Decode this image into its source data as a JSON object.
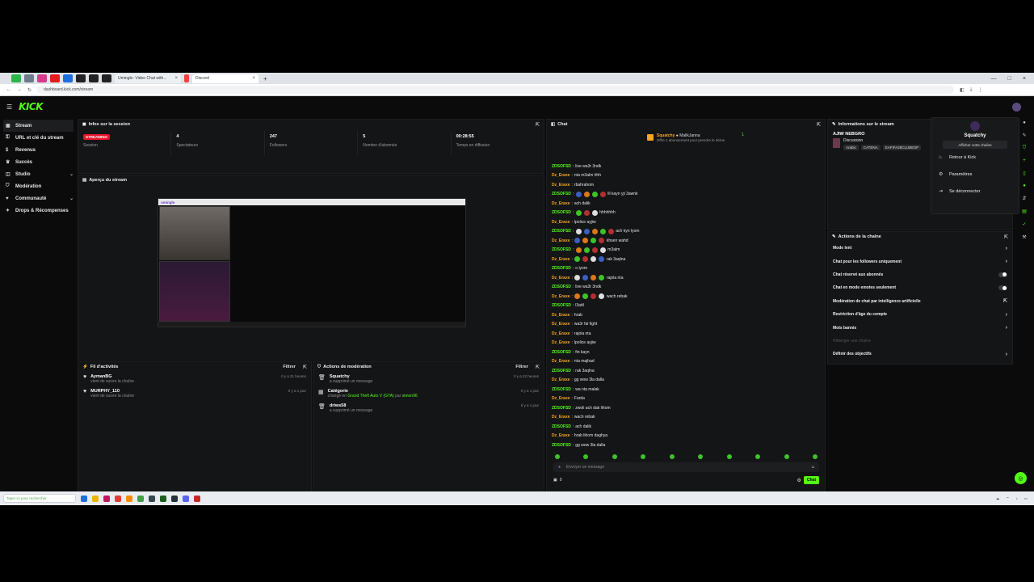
{
  "browser": {
    "tabs": [
      {
        "label": "Umingle- Video Chat with..."
      },
      {
        "label": "Discord"
      }
    ],
    "url": "dashboard.kick.com/stream"
  },
  "app": {
    "logo": "KICK",
    "accent": "#53fc18"
  },
  "sidebar": {
    "items": [
      {
        "label": "Stream",
        "icon": "stream-icon"
      },
      {
        "label": "URL et clé du stream",
        "icon": "link-icon"
      },
      {
        "label": "Revenus",
        "icon": "dollar-icon"
      },
      {
        "label": "Succès",
        "icon": "trophy-icon"
      },
      {
        "label": "Studio",
        "icon": "studio-icon"
      },
      {
        "label": "Modération",
        "icon": "shield-icon"
      },
      {
        "label": "Communauté",
        "icon": "community-icon"
      },
      {
        "label": "Drops & Récompenses",
        "icon": "gift-icon"
      }
    ]
  },
  "session": {
    "title": "Infos sur la session",
    "status": "STREAMING",
    "status_label": "Session",
    "stats": [
      {
        "value": "4",
        "label": "Spectateurs"
      },
      {
        "value": "247",
        "label": "Followers"
      },
      {
        "value": "5",
        "label": "Nombre d'abonnés"
      },
      {
        "value": "00:28:55",
        "label": "Temps en diffusion"
      }
    ]
  },
  "preview": {
    "title": "Aperçu du stream",
    "site": "umingle"
  },
  "activity": {
    "title": "Fil d'activités",
    "filter": "Filtrer",
    "items": [
      {
        "name": "AymanBG",
        "sub": "vient de suivre la chaîne",
        "time": "Il y a 21 heures"
      },
      {
        "name": "MURPHY_110",
        "sub": "vient de suivre la chaîne",
        "time": "Il y a 1 jour"
      }
    ]
  },
  "moderation": {
    "title": "Actions de modération",
    "filter": "Filtrer",
    "items": [
      {
        "name": "Squatchy",
        "sub": "a supprimé un message",
        "time": "Il y a 22 heures"
      },
      {
        "name": "Catégorie",
        "sub_prefix": "changé en",
        "sub_game": "Grand Theft Auto V (GTA)",
        "sub_mid": "par",
        "sub_user": "simon96",
        "time": "Il y a 1 jour"
      },
      {
        "name": "driws58",
        "sub": "a supprimé un message",
        "time": "Il y a 1 jour"
      }
    ]
  },
  "chat": {
    "title": "Chat",
    "pinned_user": "Squatchy",
    "pinned_target": "MalikJanna",
    "pinned_sub": "Offre 1 abonnement pour prendre le 3ème",
    "pinned_count": "1",
    "messages": [
      {
        "user": "ZDSOFSD",
        "color": "#53fc18",
        "text": "live wa3r 3ndk",
        "emotes": 0
      },
      {
        "user": "Dz_Eraxe",
        "color": "#f5a623",
        "text": "nta m3alm hhh",
        "emotes": 0
      },
      {
        "user": "Dz_Eraxe",
        "color": "#f5a623",
        "text": "rbahrahom",
        "emotes": 0
      },
      {
        "user": "ZDSOFSD",
        "color": "#53fc18",
        "text": "lli kayn yji 3awnk",
        "emotes": 4
      },
      {
        "user": "Dz_Eraxe",
        "color": "#f5a623",
        "text": "ach dalik",
        "emotes": 0
      },
      {
        "user": "ZDSOFSD",
        "color": "#53fc18",
        "text": "hhhhhhh",
        "emotes": 3
      },
      {
        "user": "Dz_Eraxe",
        "color": "#f5a623",
        "text": "lpolice ayjiw",
        "emotes": 0
      },
      {
        "user": "ZDSOFSD",
        "color": "#53fc18",
        "text": "ach kyn lyom",
        "emotes": 5
      },
      {
        "user": "Dz_Eraxe",
        "color": "#f5a623",
        "text": "khsen wahd",
        "emotes": 4
      },
      {
        "user": "ZDSOFSD",
        "color": "#53fc18",
        "text": "m3alm",
        "emotes": 4
      },
      {
        "user": "Dz_Eraxe",
        "color": "#f5a623",
        "text": "rak 3aqlna",
        "emotes": 4
      },
      {
        "user": "ZDSOFSD",
        "color": "#53fc18",
        "text": "o iyom",
        "emotes": 0
      },
      {
        "user": "Dz_Eraxe",
        "color": "#f5a623",
        "text": "rajola nta",
        "emotes": 4
      },
      {
        "user": "ZDSOFSD",
        "color": "#53fc18",
        "text": "live wa3r 3ndk",
        "emotes": 0
      },
      {
        "user": "Dz_Eraxe",
        "color": "#f5a623",
        "text": "wach rebak",
        "emotes": 4
      },
      {
        "user": "ZDSOFSD",
        "color": "#53fc18",
        "text": "l3attl",
        "emotes": 0
      },
      {
        "user": "Dz_Eraxe",
        "color": "#f5a623",
        "text": "hrab",
        "emotes": 0
      },
      {
        "user": "Dz_Eraxe",
        "color": "#f5a623",
        "text": "wa3r fal fight",
        "emotes": 0
      },
      {
        "user": "Dz_Eraxe",
        "color": "#f5a623",
        "text": "rajola nta",
        "emotes": 0
      },
      {
        "user": "Dz_Eraxe",
        "color": "#f5a623",
        "text": "lpolice ayjiw",
        "emotes": 0
      },
      {
        "user": "ZDSOFSD",
        "color": "#53fc18",
        "text": "fin kayn",
        "emotes": 0
      },
      {
        "user": "Dz_Eraxe",
        "color": "#f5a623",
        "text": "nta majhad",
        "emotes": 0
      },
      {
        "user": "ZDSOFSD",
        "color": "#53fc18",
        "text": "rak 3aqlna",
        "emotes": 0
      },
      {
        "user": "Dz_Eraxe",
        "color": "#f5a623",
        "text": "gg wow 3la dalla",
        "emotes": 0
      },
      {
        "user": "ZDSOFSD",
        "color": "#53fc18",
        "text": "wa nta malak",
        "emotes": 0
      },
      {
        "user": "Dz_Eraxe",
        "color": "#f5a623",
        "text": "Farda",
        "emotes": 0
      },
      {
        "user": "ZDSOFSD",
        "color": "#53fc18",
        "text": "zwoli ach dak lihom",
        "emotes": 0
      },
      {
        "user": "Dz_Eraxe",
        "color": "#f5a623",
        "text": "wach rebak",
        "emotes": 0
      },
      {
        "user": "ZDSOFSD",
        "color": "#53fc18",
        "text": "ach dalik",
        "emotes": 0
      },
      {
        "user": "Dz_Eraxe",
        "color": "#f5a623",
        "text": "hrab lihom daghya",
        "emotes": 0
      },
      {
        "user": "ZDSOFSD",
        "color": "#53fc18",
        "text": "gg wow 3la dalla",
        "emotes": 0
      }
    ],
    "input_placeholder": "Envoyer un message",
    "points": "0",
    "send_label": "Chat"
  },
  "streaminfo": {
    "title": "Informations sur le stream",
    "stream_title": "AJIW NEBGRO",
    "category": "Discussion",
    "tags": [
      "Arabic",
      "CATENA",
      "EAFIFA28CLUBESP"
    ]
  },
  "channel_actions": {
    "title": "Actions de la chaîne",
    "rows": [
      {
        "label": "Mode lent",
        "kind": "chevron"
      },
      {
        "label": "Chat pour les followers uniquement",
        "kind": "chevron"
      },
      {
        "label": "Chat réservé aux abonnés",
        "kind": "toggle"
      },
      {
        "label": "Chat en mode emotes seulement",
        "kind": "toggle"
      },
      {
        "label": "Modération de chat par intelligence artificielle",
        "kind": "ext"
      },
      {
        "label": "Restriction d'âge du compte",
        "kind": "chevron"
      },
      {
        "label": "Mots bannis",
        "kind": "chevron"
      },
      {
        "label": "Héberger une chaîne",
        "kind": "disabled"
      },
      {
        "label": "Définir des objectifs",
        "kind": "chevron"
      }
    ]
  },
  "user_menu": {
    "username": "Squatchy",
    "show_channel": "Afficher votre chaîne",
    "items": [
      {
        "label": "Retour à Kick",
        "icon": "home-icon"
      },
      {
        "label": "Paramètres",
        "icon": "gear-icon"
      },
      {
        "label": "Se déconnecter",
        "icon": "logout-icon"
      }
    ]
  },
  "taskbar": {
    "search": "Taper ici pour rechercher"
  }
}
